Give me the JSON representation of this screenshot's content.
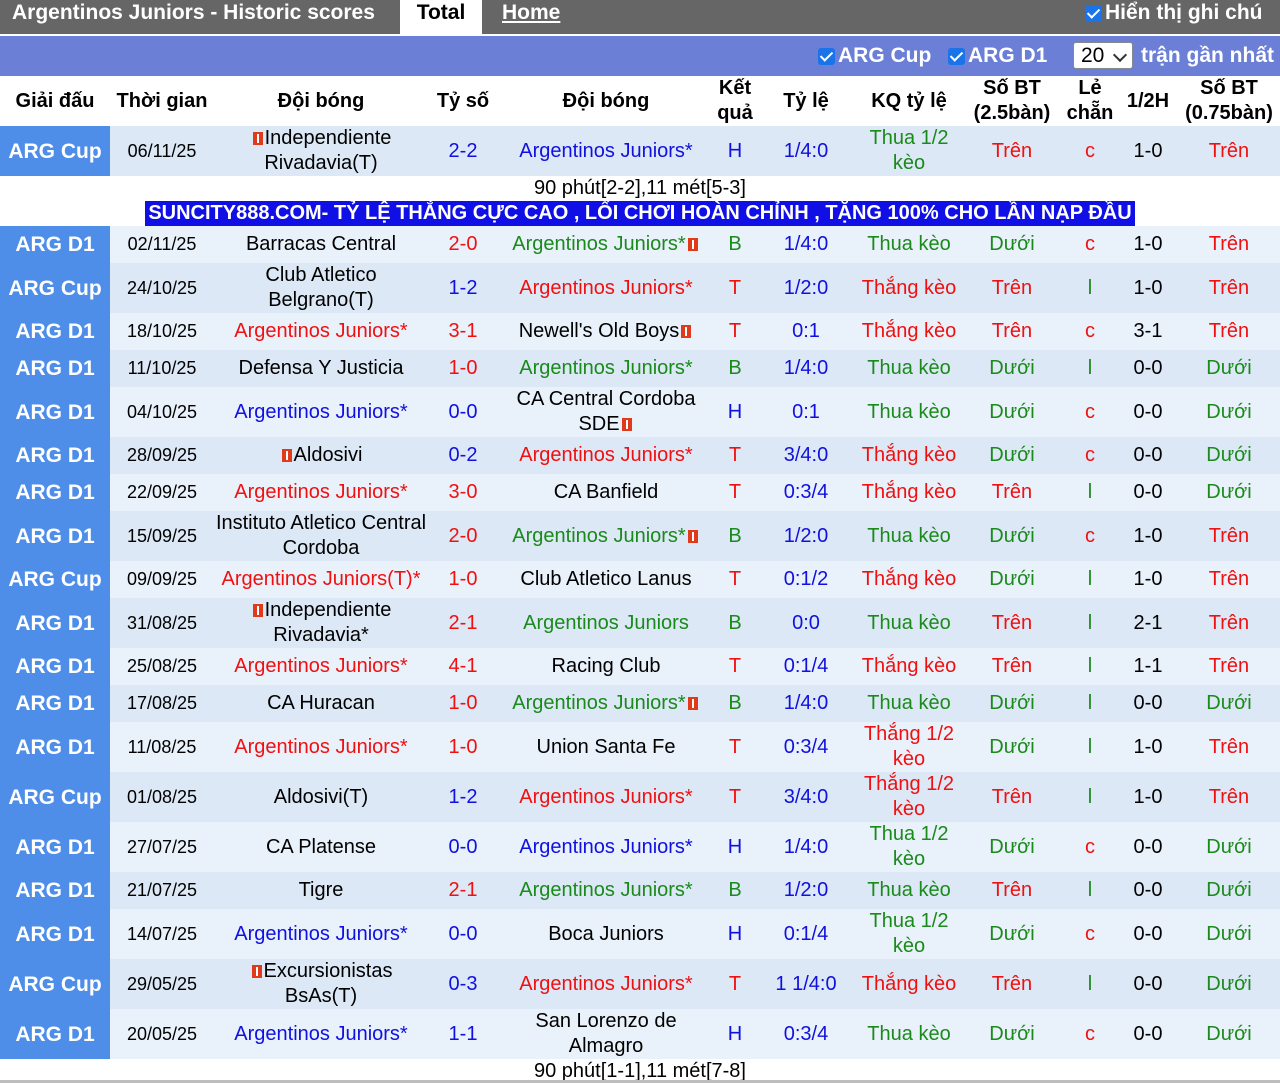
{
  "header": {
    "title": "Argentinos Juniors - Historic scores",
    "tabs": [
      {
        "label": "Total"
      },
      {
        "label": "Home"
      }
    ],
    "show_notes_label": "Hiển thị ghi chú"
  },
  "filters": {
    "arg_cup_label": "ARG Cup",
    "arg_d1_label": "ARG D1",
    "count_value": "20",
    "recent_label": "trận gần nhất"
  },
  "columns": {
    "league": "Giải đấu",
    "time": "Thời gian",
    "home": "Đội bóng",
    "score": "Tỷ số",
    "away": "Đội bóng",
    "result": "Kết quả",
    "odds": "Tỷ lệ",
    "odds_result": "KQ tỷ lệ",
    "goals_25": "Số BT (2.5bàn)",
    "odd_even": "Lẻ chẵn",
    "half": "1/2H",
    "goals_075": "Số BT (0.75bàn)"
  },
  "promo_text": "SUNCITY888.COM- TỶ LỆ THẮNG CỰC CAO , LỐI CHƠI HOÀN CHỈNH , TẶNG 100% CHO LẦN NẠP ĐẦU",
  "matches": [
    {
      "league": "ARG Cup",
      "date": "06/11/25",
      "home": "Independiente Rivadavia(T)",
      "home_card": true,
      "home_color": "black",
      "score": "2-2",
      "score_color": "blue",
      "away": "Argentinos Juniors*",
      "away_card": false,
      "away_color": "blue",
      "result": "H",
      "result_color": "blue",
      "odds": "1/4:0",
      "odds_result": "Thua 1/2 kèo",
      "odds_result_color": "green",
      "g25": "Trên",
      "g25_color": "red",
      "oe": "c",
      "oe_color": "red",
      "half": "1-0",
      "g075": "Trên",
      "g075_color": "red",
      "note": "90 phút[2-2],11 mét[5-3]"
    },
    {
      "league": "ARG D1",
      "date": "02/11/25",
      "home": "Barracas Central",
      "home_card": false,
      "home_color": "black",
      "score": "2-0",
      "score_color": "red",
      "away": "Argentinos Juniors*",
      "away_card": true,
      "away_color": "green",
      "result": "B",
      "result_color": "green",
      "odds": "1/4:0",
      "odds_result": "Thua kèo",
      "odds_result_color": "green",
      "g25": "Dưới",
      "g25_color": "green",
      "oe": "c",
      "oe_color": "red",
      "half": "1-0",
      "g075": "Trên",
      "g075_color": "red"
    },
    {
      "league": "ARG Cup",
      "date": "24/10/25",
      "home": "Club Atletico Belgrano(T)",
      "home_card": false,
      "home_color": "black",
      "score": "1-2",
      "score_color": "blue",
      "away": "Argentinos Juniors*",
      "away_card": false,
      "away_color": "red",
      "result": "T",
      "result_color": "red",
      "odds": "1/2:0",
      "odds_result": "Thắng kèo",
      "odds_result_color": "red",
      "g25": "Trên",
      "g25_color": "red",
      "oe": "l",
      "oe_color": "green",
      "half": "1-0",
      "g075": "Trên",
      "g075_color": "red"
    },
    {
      "league": "ARG D1",
      "date": "18/10/25",
      "home": "Argentinos Juniors*",
      "home_card": false,
      "home_color": "red",
      "score": "3-1",
      "score_color": "red",
      "away": "Newell's Old Boys",
      "away_card": true,
      "away_color": "black",
      "result": "T",
      "result_color": "red",
      "odds": "0:1",
      "odds_result": "Thắng kèo",
      "odds_result_color": "red",
      "g25": "Trên",
      "g25_color": "red",
      "oe": "c",
      "oe_color": "red",
      "half": "3-1",
      "g075": "Trên",
      "g075_color": "red"
    },
    {
      "league": "ARG D1",
      "date": "11/10/25",
      "home": "Defensa Y Justicia",
      "home_card": false,
      "home_color": "black",
      "score": "1-0",
      "score_color": "red",
      "away": "Argentinos Juniors*",
      "away_card": false,
      "away_color": "green",
      "result": "B",
      "result_color": "green",
      "odds": "1/4:0",
      "odds_result": "Thua kèo",
      "odds_result_color": "green",
      "g25": "Dưới",
      "g25_color": "green",
      "oe": "l",
      "oe_color": "green",
      "half": "0-0",
      "g075": "Dưới",
      "g075_color": "green"
    },
    {
      "league": "ARG D1",
      "date": "04/10/25",
      "home": "Argentinos Juniors*",
      "home_card": false,
      "home_color": "blue",
      "score": "0-0",
      "score_color": "blue",
      "away": "CA Central Cordoba SDE",
      "away_card": true,
      "away_color": "black",
      "result": "H",
      "result_color": "blue",
      "odds": "0:1",
      "odds_result": "Thua kèo",
      "odds_result_color": "green",
      "g25": "Dưới",
      "g25_color": "green",
      "oe": "c",
      "oe_color": "red",
      "half": "0-0",
      "g075": "Dưới",
      "g075_color": "green"
    },
    {
      "league": "ARG D1",
      "date": "28/09/25",
      "home": "Aldosivi",
      "home_card": true,
      "home_color": "black",
      "score": "0-2",
      "score_color": "blue",
      "away": "Argentinos Juniors*",
      "away_card": false,
      "away_color": "red",
      "result": "T",
      "result_color": "red",
      "odds": "3/4:0",
      "odds_result": "Thắng kèo",
      "odds_result_color": "red",
      "g25": "Dưới",
      "g25_color": "green",
      "oe": "c",
      "oe_color": "red",
      "half": "0-0",
      "g075": "Dưới",
      "g075_color": "green"
    },
    {
      "league": "ARG D1",
      "date": "22/09/25",
      "home": "Argentinos Juniors*",
      "home_card": false,
      "home_color": "red",
      "score": "3-0",
      "score_color": "red",
      "away": "CA Banfield",
      "away_card": false,
      "away_color": "black",
      "result": "T",
      "result_color": "red",
      "odds": "0:3/4",
      "odds_result": "Thắng kèo",
      "odds_result_color": "red",
      "g25": "Trên",
      "g25_color": "red",
      "oe": "l",
      "oe_color": "green",
      "half": "0-0",
      "g075": "Dưới",
      "g075_color": "green"
    },
    {
      "league": "ARG D1",
      "date": "15/09/25",
      "home": "Instituto Atletico Central Cordoba",
      "home_card": false,
      "home_color": "black",
      "score": "2-0",
      "score_color": "red",
      "away": "Argentinos Juniors*",
      "away_card": true,
      "away_color": "green",
      "result": "B",
      "result_color": "green",
      "odds": "1/2:0",
      "odds_result": "Thua kèo",
      "odds_result_color": "green",
      "g25": "Dưới",
      "g25_color": "green",
      "oe": "c",
      "oe_color": "red",
      "half": "1-0",
      "g075": "Trên",
      "g075_color": "red"
    },
    {
      "league": "ARG Cup",
      "date": "09/09/25",
      "home": "Argentinos Juniors(T)*",
      "home_card": false,
      "home_color": "red",
      "score": "1-0",
      "score_color": "red",
      "away": "Club Atletico Lanus",
      "away_card": false,
      "away_color": "black",
      "result": "T",
      "result_color": "red",
      "odds": "0:1/2",
      "odds_result": "Thắng kèo",
      "odds_result_color": "red",
      "g25": "Dưới",
      "g25_color": "green",
      "oe": "l",
      "oe_color": "green",
      "half": "1-0",
      "g075": "Trên",
      "g075_color": "red"
    },
    {
      "league": "ARG D1",
      "date": "31/08/25",
      "home": "Independiente Rivadavia*",
      "home_card": true,
      "home_color": "black",
      "score": "2-1",
      "score_color": "red",
      "away": "Argentinos Juniors",
      "away_card": false,
      "away_color": "green",
      "result": "B",
      "result_color": "green",
      "odds": "0:0",
      "odds_result": "Thua kèo",
      "odds_result_color": "green",
      "g25": "Trên",
      "g25_color": "red",
      "oe": "l",
      "oe_color": "green",
      "half": "2-1",
      "g075": "Trên",
      "g075_color": "red"
    },
    {
      "league": "ARG D1",
      "date": "25/08/25",
      "home": "Argentinos Juniors*",
      "home_card": false,
      "home_color": "red",
      "score": "4-1",
      "score_color": "red",
      "away": "Racing Club",
      "away_card": false,
      "away_color": "black",
      "result": "T",
      "result_color": "red",
      "odds": "0:1/4",
      "odds_result": "Thắng kèo",
      "odds_result_color": "red",
      "g25": "Trên",
      "g25_color": "red",
      "oe": "l",
      "oe_color": "green",
      "half": "1-1",
      "g075": "Trên",
      "g075_color": "red"
    },
    {
      "league": "ARG D1",
      "date": "17/08/25",
      "home": "CA Huracan",
      "home_card": false,
      "home_color": "black",
      "score": "1-0",
      "score_color": "red",
      "away": "Argentinos Juniors*",
      "away_card": true,
      "away_color": "green",
      "result": "B",
      "result_color": "green",
      "odds": "1/4:0",
      "odds_result": "Thua kèo",
      "odds_result_color": "green",
      "g25": "Dưới",
      "g25_color": "green",
      "oe": "l",
      "oe_color": "green",
      "half": "0-0",
      "g075": "Dưới",
      "g075_color": "green"
    },
    {
      "league": "ARG D1",
      "date": "11/08/25",
      "home": "Argentinos Juniors*",
      "home_card": false,
      "home_color": "red",
      "score": "1-0",
      "score_color": "red",
      "away": "Union Santa Fe",
      "away_card": false,
      "away_color": "black",
      "result": "T",
      "result_color": "red",
      "odds": "0:3/4",
      "odds_result": "Thắng 1/2 kèo",
      "odds_result_color": "red",
      "g25": "Dưới",
      "g25_color": "green",
      "oe": "l",
      "oe_color": "green",
      "half": "1-0",
      "g075": "Trên",
      "g075_color": "red"
    },
    {
      "league": "ARG Cup",
      "date": "01/08/25",
      "home": "Aldosivi(T)",
      "home_card": false,
      "home_color": "black",
      "score": "1-2",
      "score_color": "blue",
      "away": "Argentinos Juniors*",
      "away_card": false,
      "away_color": "red",
      "result": "T",
      "result_color": "red",
      "odds": "3/4:0",
      "odds_result": "Thắng 1/2 kèo",
      "odds_result_color": "red",
      "g25": "Trên",
      "g25_color": "red",
      "oe": "l",
      "oe_color": "green",
      "half": "1-0",
      "g075": "Trên",
      "g075_color": "red"
    },
    {
      "league": "ARG D1",
      "date": "27/07/25",
      "home": "CA Platense",
      "home_card": false,
      "home_color": "black",
      "score": "0-0",
      "score_color": "blue",
      "away": "Argentinos Juniors*",
      "away_card": false,
      "away_color": "blue",
      "result": "H",
      "result_color": "blue",
      "odds": "1/4:0",
      "odds_result": "Thua 1/2 kèo",
      "odds_result_color": "green",
      "g25": "Dưới",
      "g25_color": "green",
      "oe": "c",
      "oe_color": "red",
      "half": "0-0",
      "g075": "Dưới",
      "g075_color": "green"
    },
    {
      "league": "ARG D1",
      "date": "21/07/25",
      "home": "Tigre",
      "home_card": false,
      "home_color": "black",
      "score": "2-1",
      "score_color": "red",
      "away": "Argentinos Juniors*",
      "away_card": false,
      "away_color": "green",
      "result": "B",
      "result_color": "green",
      "odds": "1/2:0",
      "odds_result": "Thua kèo",
      "odds_result_color": "green",
      "g25": "Trên",
      "g25_color": "red",
      "oe": "l",
      "oe_color": "green",
      "half": "0-0",
      "g075": "Dưới",
      "g075_color": "green"
    },
    {
      "league": "ARG D1",
      "date": "14/07/25",
      "home": "Argentinos Juniors*",
      "home_card": false,
      "home_color": "blue",
      "score": "0-0",
      "score_color": "blue",
      "away": "Boca Juniors",
      "away_card": false,
      "away_color": "black",
      "result": "H",
      "result_color": "blue",
      "odds": "0:1/4",
      "odds_result": "Thua 1/2 kèo",
      "odds_result_color": "green",
      "g25": "Dưới",
      "g25_color": "green",
      "oe": "c",
      "oe_color": "red",
      "half": "0-0",
      "g075": "Dưới",
      "g075_color": "green"
    },
    {
      "league": "ARG Cup",
      "date": "29/05/25",
      "home": "Excursionistas BsAs(T)",
      "home_card": true,
      "home_color": "black",
      "score": "0-3",
      "score_color": "blue",
      "away": "Argentinos Juniors*",
      "away_card": false,
      "away_color": "red",
      "result": "T",
      "result_color": "red",
      "odds": "1 1/4:0",
      "odds_result": "Thắng kèo",
      "odds_result_color": "red",
      "g25": "Trên",
      "g25_color": "red",
      "oe": "l",
      "oe_color": "green",
      "half": "0-0",
      "g075": "Dưới",
      "g075_color": "green"
    },
    {
      "league": "ARG D1",
      "date": "20/05/25",
      "home": "Argentinos Juniors*",
      "home_card": false,
      "home_color": "blue",
      "score": "1-1",
      "score_color": "blue",
      "away": "San Lorenzo de Almagro",
      "away_card": false,
      "away_color": "black",
      "result": "H",
      "result_color": "blue",
      "odds": "0:3/4",
      "odds_result": "Thua kèo",
      "odds_result_color": "green",
      "g25": "Dưới",
      "g25_color": "green",
      "oe": "c",
      "oe_color": "red",
      "half": "0-0",
      "g075": "Dưới",
      "g075_color": "green",
      "note": "90 phút[1-1],11 mét[7-8]"
    }
  ]
}
